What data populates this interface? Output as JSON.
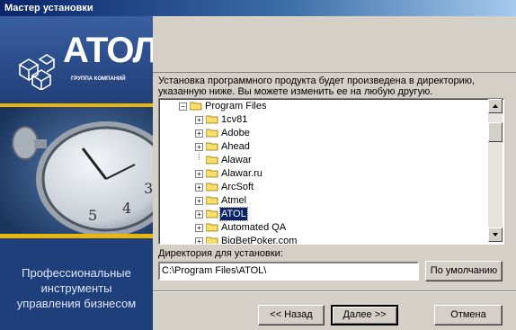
{
  "window": {
    "title": "Мастер установки"
  },
  "sidebar": {
    "logo_text": "АТОЛ",
    "logo_subtext": "ГРУППА КОМПАНИЙ",
    "tagline_lines": [
      "Профессиональные",
      "инструменты",
      "управления бизнесом"
    ],
    "accent_color": "#e8b70c"
  },
  "instructions": "Установка программного продукта будет произведена в директорию, указанную ниже. Вы можете изменить ее на любую другую.",
  "tree": {
    "root": "Program Files",
    "items": [
      "1cv81",
      "Adobe",
      "Ahead",
      "Alawar",
      "Alawar.ru",
      "ArcSoft",
      "Atmel",
      "ATOL",
      "Automated QA",
      "BigBetPoker.com"
    ],
    "selected": "ATOL",
    "icons": [
      "folder-icon",
      "expand-plus-icon"
    ]
  },
  "directory": {
    "label": "Директория для установки:",
    "value": "C:\\Program Files\\ATOL\\",
    "default_button": "По умолчанию"
  },
  "buttons": {
    "back": "<< Назад",
    "next": "Далее >>",
    "cancel": "Отмена"
  }
}
